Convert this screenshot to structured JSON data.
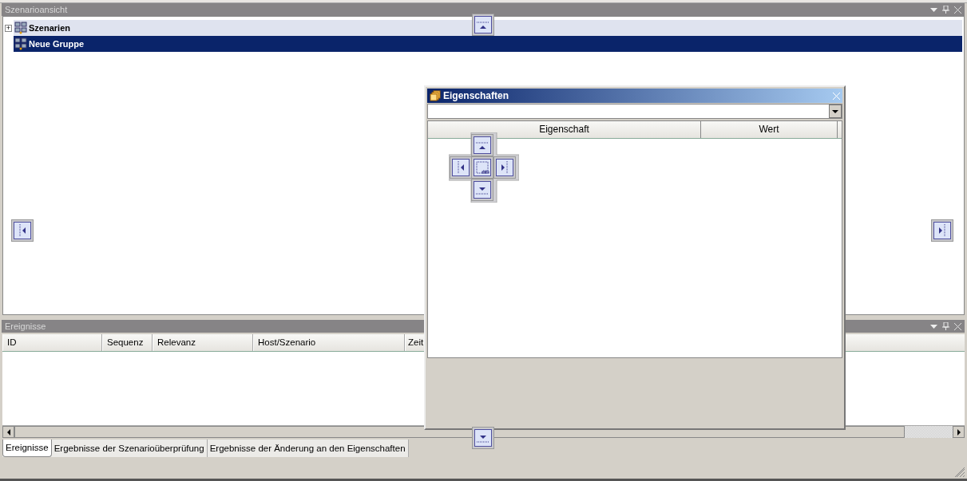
{
  "scenario_pane": {
    "title": "Szenarioansicht",
    "tree": [
      {
        "label": "Szenarien",
        "expander": "+",
        "selected": false,
        "hovered": true
      },
      {
        "label": "Neue Gruppe",
        "selected": true,
        "hovered": false
      }
    ]
  },
  "events_pane": {
    "title": "Ereignisse",
    "columns": [
      "ID",
      "Sequenz",
      "Relevanz",
      "Host/Szenario",
      "Zeit"
    ]
  },
  "properties_window": {
    "title": "Eigenschaften",
    "columns": [
      "Eigenschaft",
      "Wert"
    ]
  },
  "bottom_tabs": [
    {
      "label": "Ereignisse",
      "selected": true
    },
    {
      "label": "Ergebnisse der Szenarioüberprüfung",
      "selected": false
    },
    {
      "label": "Ergebnisse der Änderung an den Eigenschaften",
      "selected": false
    }
  ]
}
